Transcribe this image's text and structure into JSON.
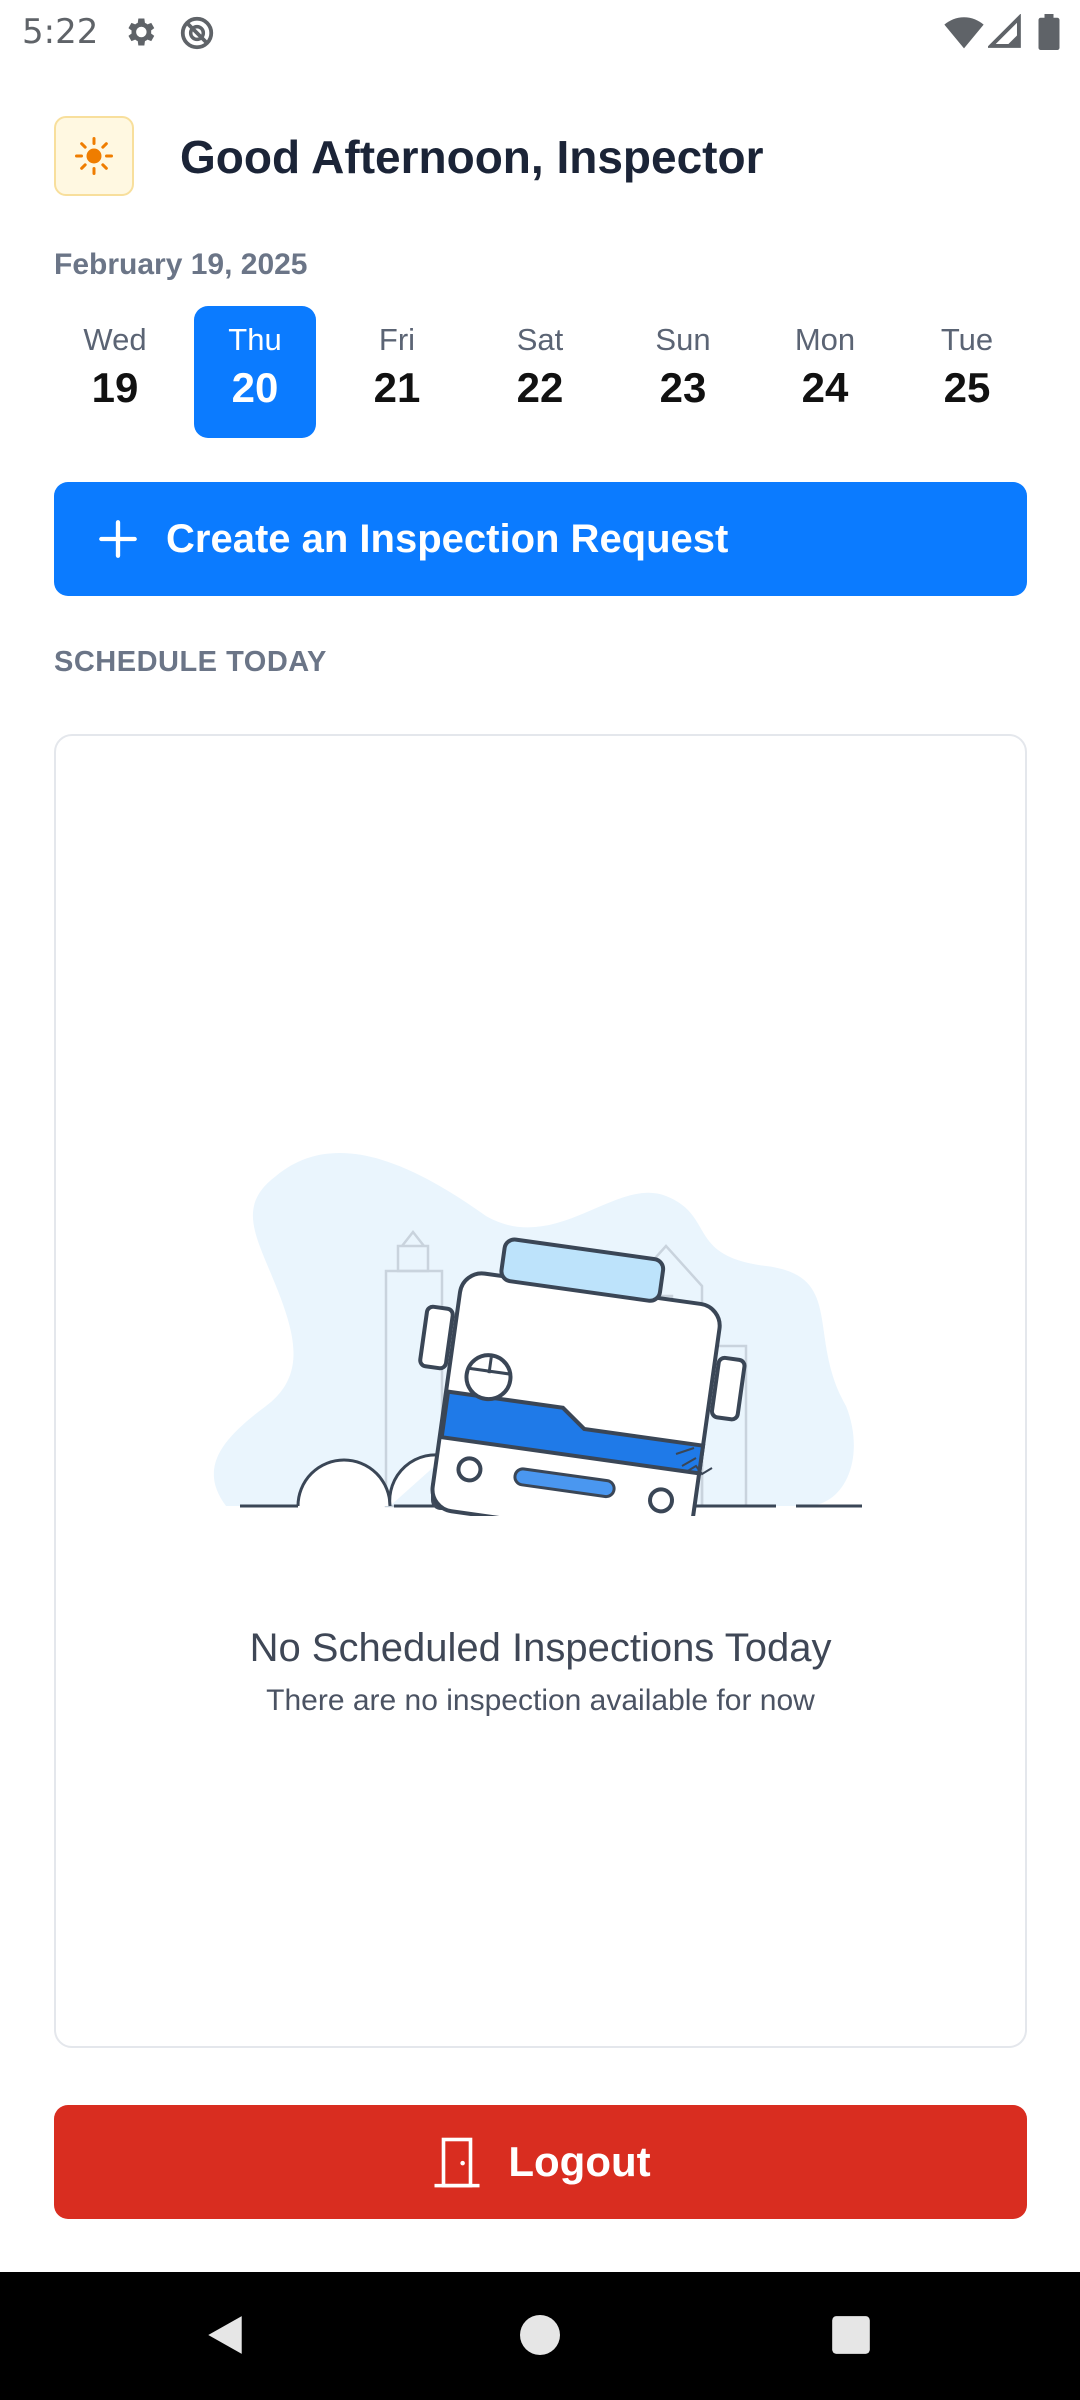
{
  "status_bar": {
    "time": "5:22",
    "icons": [
      "gear-icon",
      "no-sync-icon",
      "wifi-icon",
      "signal-icon",
      "battery-icon"
    ]
  },
  "header": {
    "greeting_icon": "sun-icon",
    "greeting": "Good Afternoon, Inspector",
    "date": "February 19, 2025"
  },
  "days": [
    {
      "name": "Wed",
      "num": "19"
    },
    {
      "name": "Thu",
      "num": "20"
    },
    {
      "name": "Fri",
      "num": "21"
    },
    {
      "name": "Sat",
      "num": "22"
    },
    {
      "name": "Sun",
      "num": "23"
    },
    {
      "name": "Mon",
      "num": "24"
    },
    {
      "name": "Tue",
      "num": "25"
    }
  ],
  "selected_day": "Thu",
  "create_button": {
    "icon": "plus-icon",
    "label": "Create an Inspection Request"
  },
  "schedule": {
    "section_title": "SCHEDULE TODAY",
    "empty_title": "No Scheduled Inspections Today",
    "empty_subtitle": "There are no inspection available for now"
  },
  "logout_button": {
    "icon": "door-exit-icon",
    "label": "Logout"
  },
  "nav": [
    "back-icon",
    "home-icon",
    "recents-icon"
  ],
  "colors": {
    "primary": "#0b7bff",
    "danger": "#d92d20",
    "text_dark": "#1b2437",
    "text_muted": "#6b7587"
  }
}
